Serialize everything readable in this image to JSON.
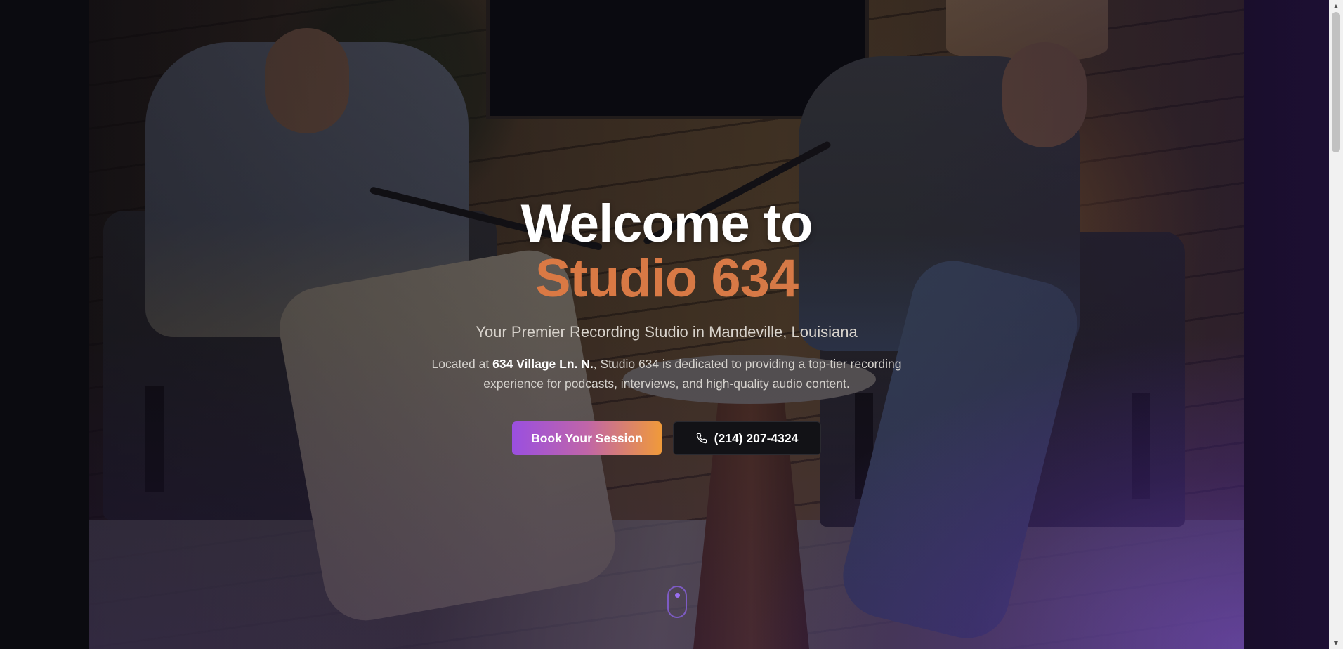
{
  "hero": {
    "title_line1": "Welcome to",
    "title_line2": "Studio 634",
    "subtitle": "Your Premier Recording Studio in Mandeville, Louisiana",
    "description_prefix": "Located at ",
    "description_address": "634 Village Ln. N.",
    "description_suffix": ", Studio 634 is dedicated to providing a top-tier recording experience for podcasts, interviews, and high-quality audio content."
  },
  "actions": {
    "book_label": "Book Your Session",
    "phone_label": "(214) 207-4324",
    "phone_icon": "phone-icon"
  },
  "scroll_indicator": {
    "icon": "mouse-scroll-icon"
  },
  "colors": {
    "accent_orange": "#e07840",
    "gradient_start": "#9a4fe0",
    "gradient_end": "#f09a3a",
    "phone_button_bg": "#121216"
  }
}
